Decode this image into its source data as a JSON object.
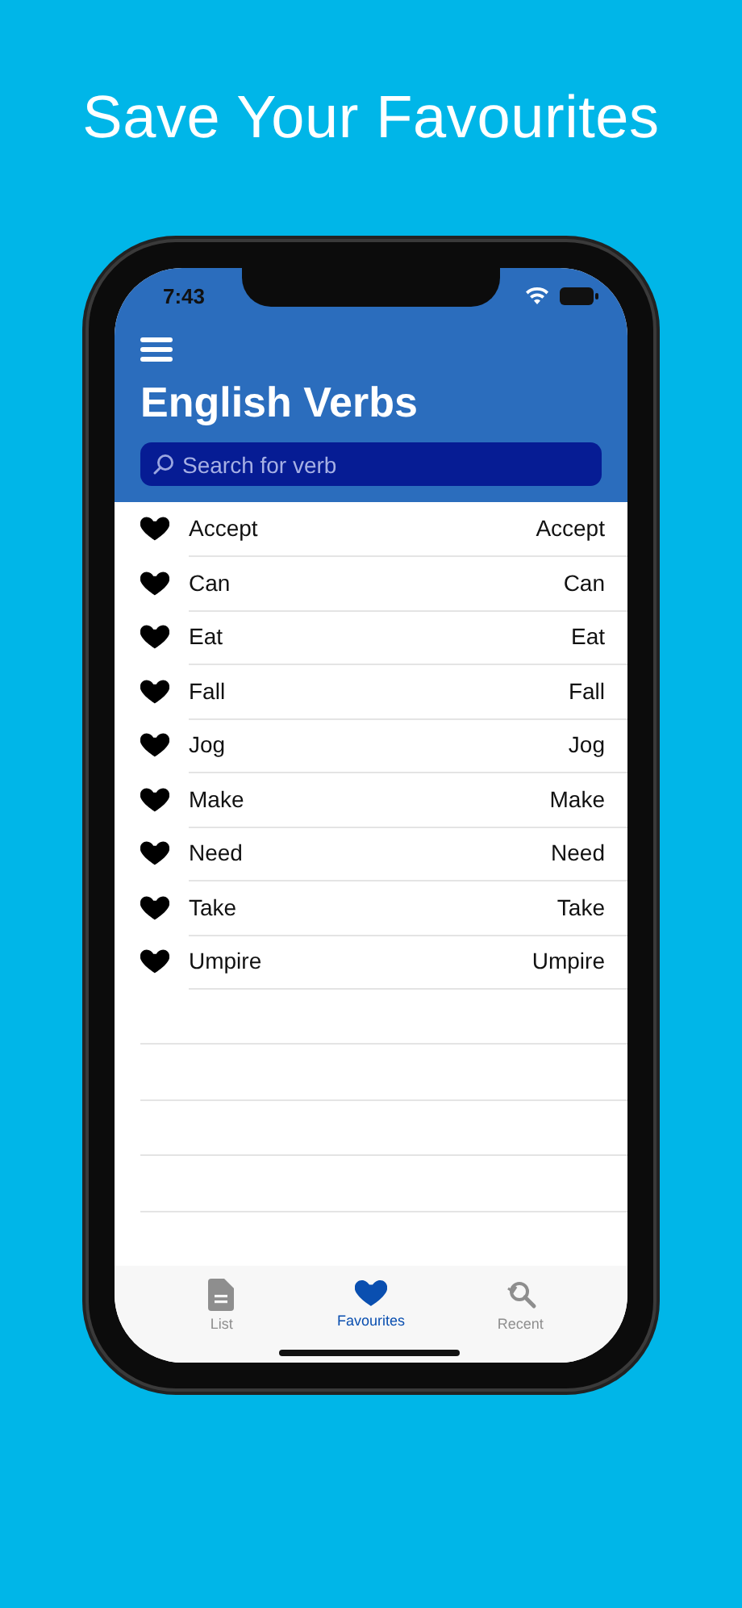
{
  "headline": "Save Your Favourites",
  "status_bar": {
    "time": "7:43"
  },
  "header": {
    "title": "English Verbs",
    "search": {
      "placeholder": "Search for verb"
    }
  },
  "verbs": [
    {
      "name": "Accept",
      "translation": "Accept",
      "favourite": true
    },
    {
      "name": "Can",
      "translation": "Can",
      "favourite": true
    },
    {
      "name": "Eat",
      "translation": "Eat",
      "favourite": true
    },
    {
      "name": "Fall",
      "translation": "Fall",
      "favourite": true
    },
    {
      "name": "Jog",
      "translation": "Jog",
      "favourite": true
    },
    {
      "name": "Make",
      "translation": "Make",
      "favourite": true
    },
    {
      "name": "Need",
      "translation": "Need",
      "favourite": true
    },
    {
      "name": "Take",
      "translation": "Take",
      "favourite": true
    },
    {
      "name": "Umpire",
      "translation": "Umpire",
      "favourite": true
    }
  ],
  "tabs": [
    {
      "kind": "list",
      "label": "List",
      "selected": false
    },
    {
      "kind": "favourites",
      "label": "Favourites",
      "selected": true
    },
    {
      "kind": "recent",
      "label": "Recent",
      "selected": false
    }
  ]
}
